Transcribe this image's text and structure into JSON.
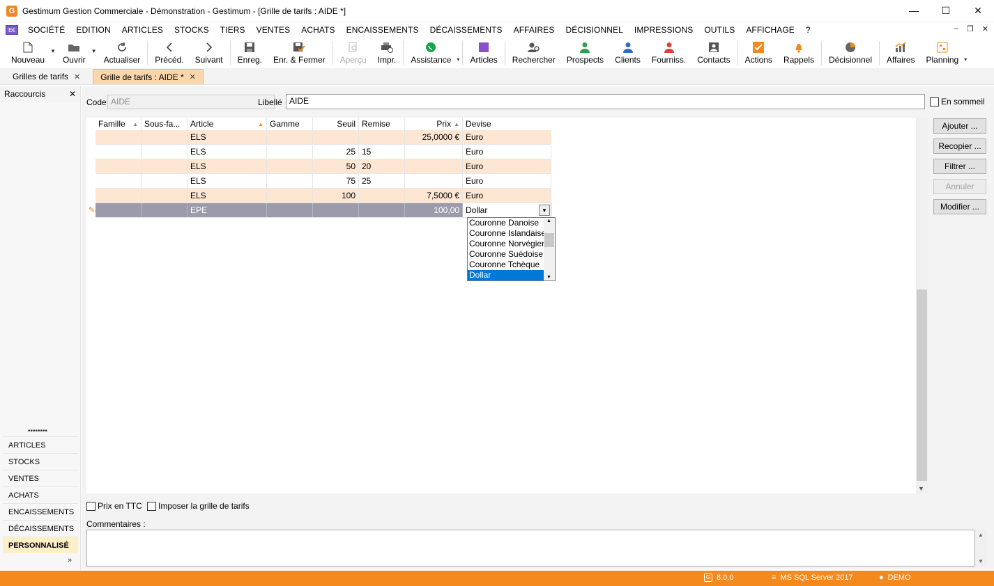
{
  "window": {
    "logo_letter": "G",
    "title": "Gestimum Gestion Commerciale - Démonstration - Gestimum - [Grille de tarifs : AIDE *]",
    "minimize": "—",
    "maximize": "☐",
    "close": "✕"
  },
  "menu": {
    "icon_text": "E€",
    "items": [
      "SOCIÉTÉ",
      "EDITION",
      "ARTICLES",
      "STOCKS",
      "TIERS",
      "VENTES",
      "ACHATS",
      "ENCAISSEMENTS",
      "DÉCAISSEMENTS",
      "AFFAIRES",
      "DÉCISIONNEL",
      "IMPRESSIONS",
      "OUTILS",
      "AFFICHAGE",
      "?"
    ],
    "mdi_min": "–",
    "mdi_restore": "❐",
    "mdi_close": "✕"
  },
  "toolbar": {
    "nouveau": "Nouveau",
    "ouvrir": "Ouvrir",
    "actualiser": "Actualiser",
    "preced": "Précéd.",
    "suivant": "Suivant",
    "enreg": "Enreg.",
    "enr_fermer": "Enr. & Fermer",
    "apercu": "Aperçu",
    "impr": "Impr.",
    "assistance": "Assistance",
    "articles": "Articles",
    "rechercher": "Rechercher",
    "prospects": "Prospects",
    "clients": "Clients",
    "fourniss": "Fourniss.",
    "contacts": "Contacts",
    "actions": "Actions",
    "rappels": "Rappels",
    "decisionnel": "Décisionnel",
    "affaires": "Affaires",
    "planning": "Planning"
  },
  "tabs": {
    "grilles": "Grilles de tarifs",
    "current": "Grille de tarifs : AIDE *",
    "close": "✕"
  },
  "sidebar": {
    "title": "Raccourcis",
    "close": "✕",
    "dots": "••••••••",
    "items": [
      "ARTICLES",
      "STOCKS",
      "VENTES",
      "ACHATS",
      "ENCAISSEMENTS",
      "DÉCAISSEMENTS",
      "PERSONNALISÉ"
    ],
    "more": "»"
  },
  "form": {
    "code_label": "Code",
    "code_value": "AIDE",
    "libelle_label": "Libellé",
    "libelle_value": "AIDE",
    "en_sommeil": "En sommeil",
    "prix_ttc": "Prix en TTC",
    "imposer": "Imposer la grille de tarifs",
    "commentaires": "Commentaires :"
  },
  "grid": {
    "columns": [
      "Famille",
      "Sous-fa...",
      "Article",
      "Gamme",
      "Seuil",
      "Remise",
      "Prix",
      "Devise"
    ],
    "rows": [
      {
        "famille": "",
        "sousfam": "",
        "article": "ELS",
        "gamme": "",
        "seuil": "",
        "remise": "",
        "prix": "25,0000 €",
        "devise": "Euro"
      },
      {
        "famille": "",
        "sousfam": "",
        "article": "ELS",
        "gamme": "",
        "seuil": "25",
        "remise": "15",
        "prix": "",
        "devise": "Euro"
      },
      {
        "famille": "",
        "sousfam": "",
        "article": "ELS",
        "gamme": "",
        "seuil": "50",
        "remise": "20",
        "prix": "",
        "devise": "Euro"
      },
      {
        "famille": "",
        "sousfam": "",
        "article": "ELS",
        "gamme": "",
        "seuil": "75",
        "remise": "25",
        "prix": "",
        "devise": "Euro"
      },
      {
        "famille": "",
        "sousfam": "",
        "article": "ELS",
        "gamme": "",
        "seuil": "100",
        "remise": "",
        "prix": "7,5000 €",
        "devise": "Euro"
      }
    ],
    "edit_row": {
      "article": "EPE",
      "prix": "100,00",
      "devise": "Dollar"
    },
    "dropdown_options": [
      "Couronne Danoise",
      "Couronne Islandaise",
      "Couronne Norvégienne",
      "Couronne Suédoise",
      "Couronne Tchèque",
      "Dollar"
    ]
  },
  "buttons": {
    "ajouter": "Ajouter ...",
    "recopier": "Recopier ...",
    "filtrer": "Filtrer ...",
    "annuler": "Annuler",
    "modifier": "Modifier ..."
  },
  "status": {
    "version": "8.0.0",
    "db": "MS SQL Server 2017",
    "user": "DEMO"
  },
  "colors": {
    "accent": "#f4891e",
    "row_alt": "#fde7d3",
    "edit_row": "#9c9baa",
    "selection": "#0078d7"
  }
}
